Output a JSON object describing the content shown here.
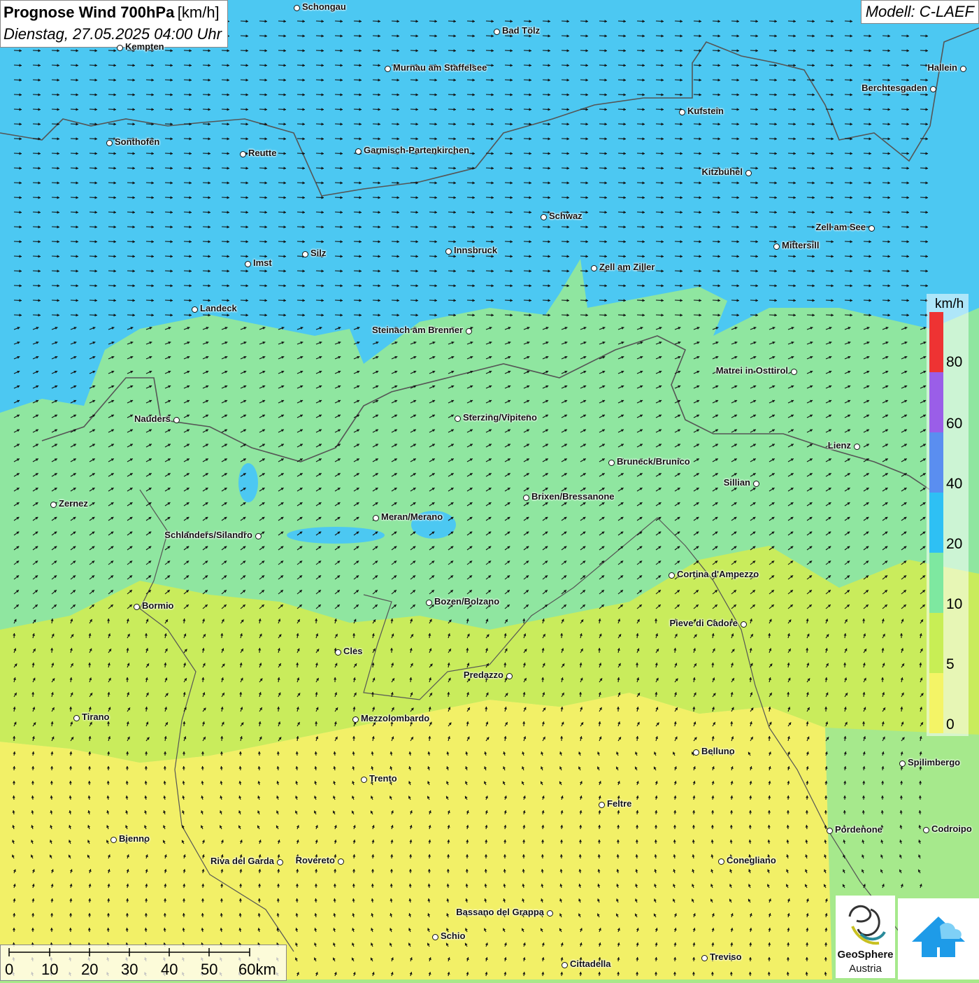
{
  "header": {
    "title": "Prognose Wind 700hPa",
    "unit": "[km/h]",
    "datetime": "Dienstag, 27.05.2025 04:00 Uhr",
    "model": "Modell: C-LAEF"
  },
  "legend": {
    "unit": "km/h",
    "labels": [
      "80",
      "60",
      "40",
      "20",
      "10",
      "5",
      "0"
    ],
    "colors": [
      "#ee3333",
      "#9a5ee8",
      "#5a8ef0",
      "#2ec0f4",
      "#7ee8a0",
      "#c8ee55",
      "#f4f466"
    ]
  },
  "scale": {
    "labels": [
      "0",
      "10",
      "20",
      "30",
      "40",
      "50",
      "60km"
    ]
  },
  "logo": {
    "name_line1": "GeoSphere",
    "name_line2": "Austria"
  },
  "cities": [
    {
      "name": "Schongau"
    },
    {
      "name": "Bad Tölz"
    },
    {
      "name": "Kempten"
    },
    {
      "name": "Murnau am Staffelsee"
    },
    {
      "name": "Hallein"
    },
    {
      "name": "Berchtesgaden"
    },
    {
      "name": "Kufstein"
    },
    {
      "name": "Sonthofen"
    },
    {
      "name": "Reutte"
    },
    {
      "name": "Garmisch-Partenkirchen"
    },
    {
      "name": "Kitzbühel"
    },
    {
      "name": "Schwaz"
    },
    {
      "name": "Zell am See"
    },
    {
      "name": "Mittersill"
    },
    {
      "name": "Silz"
    },
    {
      "name": "Innsbruck"
    },
    {
      "name": "Imst"
    },
    {
      "name": "Zell am Ziller"
    },
    {
      "name": "Landeck"
    },
    {
      "name": "Steinach am Brenner"
    },
    {
      "name": "Matrei in Osttirol"
    },
    {
      "name": "Nauders"
    },
    {
      "name": "Sterzing/Vipiteno"
    },
    {
      "name": "Lienz"
    },
    {
      "name": "Bruneck/Brunico"
    },
    {
      "name": "Sillian"
    },
    {
      "name": "Zernez"
    },
    {
      "name": "Brixen/Bressanone"
    },
    {
      "name": "Meran/Merano"
    },
    {
      "name": "Schlanders/Silandro"
    },
    {
      "name": "Cortina d'Ampezzo"
    },
    {
      "name": "Bozen/Bolzano"
    },
    {
      "name": "Bormio"
    },
    {
      "name": "Pieve di Cadore"
    },
    {
      "name": "Cles"
    },
    {
      "name": "Predazzo"
    },
    {
      "name": "Tirano"
    },
    {
      "name": "Mezzolombardo"
    },
    {
      "name": "Belluno"
    },
    {
      "name": "Spilimbergo"
    },
    {
      "name": "Trento"
    },
    {
      "name": "Feltre"
    },
    {
      "name": "Pordenone"
    },
    {
      "name": "Codroipo"
    },
    {
      "name": "Bienno"
    },
    {
      "name": "Riva del Garda"
    },
    {
      "name": "Rovereto"
    },
    {
      "name": "Conegliano"
    },
    {
      "name": "Bassano del Grappa"
    },
    {
      "name": "Schio"
    },
    {
      "name": "Treviso"
    },
    {
      "name": "Cittadella"
    }
  ]
}
